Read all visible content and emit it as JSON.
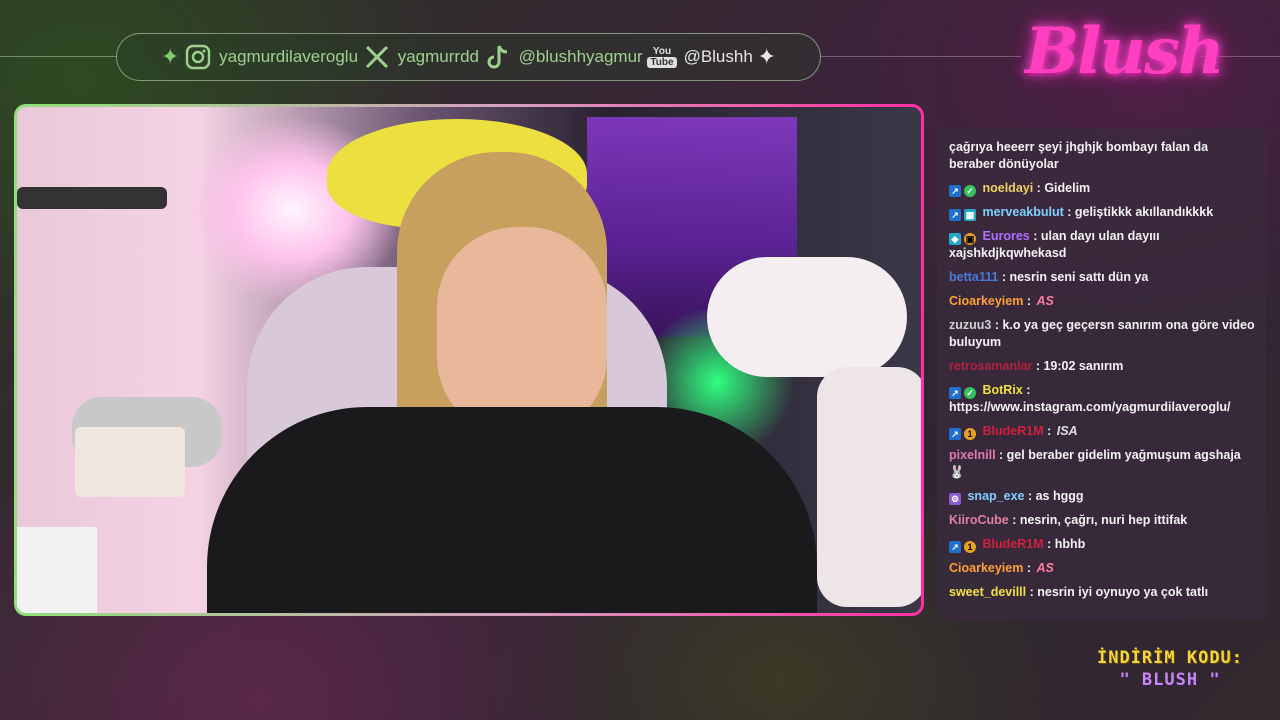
{
  "social": [
    {
      "platform_icon": "instagram-icon",
      "handle": "yagmurdilaveroglu"
    },
    {
      "platform_icon": "x-twitter-icon",
      "handle": "yagmurrdd"
    },
    {
      "platform_icon": "tiktok-icon",
      "handle": "@blushhyagmur"
    },
    {
      "platform_icon": "youtube-icon",
      "yt_top": "You",
      "yt_bottom": "Tube",
      "handle": "@Blushh"
    }
  ],
  "brand": {
    "logo_text": "Blush",
    "accent": "#ff3fc0"
  },
  "chat": {
    "messages": [
      {
        "user": "",
        "text": "çağrıya heeerr şeyi jhghjk bombayı falan da beraber dönüyolar",
        "color": "#f2f2f2"
      },
      {
        "user": "noeldayi",
        "text": "Gidelim",
        "color": "#f0d060",
        "badges": [
          "blue",
          "green"
        ]
      },
      {
        "user": "merveakbulut",
        "text": "geliştikkk akıllandıkkkk",
        "color": "#7fd0ff",
        "badges": [
          "blue",
          "cyan"
        ]
      },
      {
        "user": "Eurores",
        "text": "ulan dayı ulan dayııı xajshkdjkqwhekasd",
        "color": "#b070ff",
        "badges": [
          "blue",
          "gold"
        ]
      },
      {
        "user": "betta111",
        "text": "nesrin seni sattı dün ya",
        "color": "#4a7ad8",
        "badges": []
      },
      {
        "user": "Cioarkeyiem",
        "text": "",
        "emote": "AS",
        "color": "#ffa030",
        "badges": []
      },
      {
        "user": "zuzuu3",
        "text": "k.o ya geç geçersn sanırım ona göre video buluyum",
        "color": "#d0d0d0",
        "badges": []
      },
      {
        "user": "retrosamanlar",
        "text": "19:02 sanırım",
        "color": "#b02040",
        "badges": []
      },
      {
        "user": "BotRix",
        "text": "https://www.instagram.com/yagmurdilaveroglu/",
        "color": "#f0e040",
        "badges": [
          "blue",
          "green"
        ]
      },
      {
        "user": "BludeR1M",
        "text": "",
        "emote": "ISA",
        "color": "#d02040",
        "badges": [
          "blue",
          "gold"
        ]
      },
      {
        "user": "pixelnill",
        "text": "gel beraber gidelim yağmuşum agshaja",
        "color": "#e07ab0",
        "badges": []
      },
      {
        "user": "snap_exe",
        "text": "as hggg",
        "color": "#80d0ff",
        "badges": [
          "purple"
        ]
      },
      {
        "user": "KiiroCube",
        "text": "nesrin, çağrı, nuri hep ittifak",
        "color": "#e080a0",
        "badges": []
      },
      {
        "user": "BludeR1M",
        "text": "hbhb",
        "color": "#d02040",
        "badges": [
          "blue",
          "gold"
        ]
      },
      {
        "user": "Cioarkeyiem",
        "text": "",
        "emote": "AS",
        "color": "#ffa030",
        "badges": []
      },
      {
        "user": "sweet_devilll",
        "text": "nesrin iyi oynuyo ya çok tatlı",
        "color": "#f0e040",
        "badges": []
      }
    ]
  },
  "promo": {
    "line1": "İNDİRİM KODU:",
    "line2": "\" BLUSH \""
  }
}
